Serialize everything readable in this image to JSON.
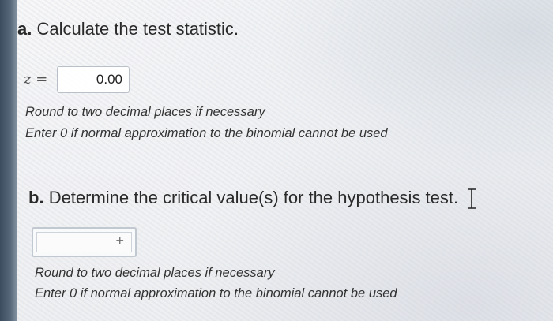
{
  "part_a": {
    "letter": "a.",
    "heading": "Calculate the test statistic.",
    "z_label": "z =",
    "z_value": "0.00",
    "hint_round": "Round to two decimal places if necessary",
    "hint_normal": "Enter 0 if normal approximation to the binomial cannot be used"
  },
  "part_b": {
    "letter": "b.",
    "heading": "Determine the critical value(s) for the hypothesis test.",
    "add_symbol": "+",
    "hint_round": "Round to two decimal places if necessary",
    "hint_normal": "Enter 0 if normal approximation to the binomial cannot be used"
  },
  "icons": {
    "cursor": "text-cursor-icon",
    "add": "plus-icon"
  }
}
